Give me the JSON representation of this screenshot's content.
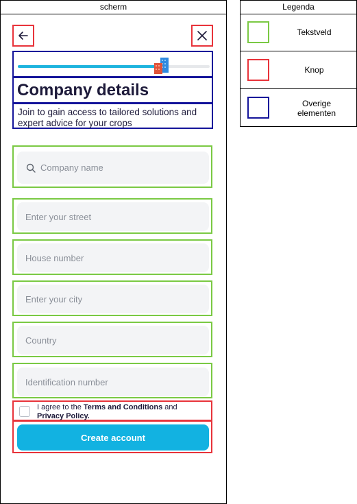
{
  "screen": {
    "label": "scherm",
    "back_icon": "arrow-left-icon",
    "close_icon": "close-icon",
    "progress_fraction": 0.77,
    "building_icon": "building-icon",
    "title": "Company details",
    "subtitle": "Join to gain access to tailored solutions and expert advice for your crops",
    "search_icon": "search-icon",
    "fields": {
      "company_name": "Company name",
      "street": "Enter your street",
      "house_number": "House number",
      "city": "Enter your city",
      "country": "Country",
      "identification": "Identification number"
    },
    "agree": {
      "prefix": "I agree to the ",
      "terms": "Terms and Conditions",
      "middle": " and",
      "privacy": "Privacy Policy."
    },
    "create_label": "Create account"
  },
  "legend": {
    "label": "Legenda",
    "items": [
      {
        "label": "Tekstveld",
        "color": "#7ac943"
      },
      {
        "label": "Knop",
        "color": "#e8333a"
      },
      {
        "label": "Overige elementen",
        "color": "#14149a"
      }
    ]
  },
  "colors": {
    "accent": "#12b2e1",
    "title": "#1d1a3a",
    "text_field_annotation": "#7ac943",
    "button_annotation": "#e8333a",
    "other_annotation": "#14149a"
  }
}
